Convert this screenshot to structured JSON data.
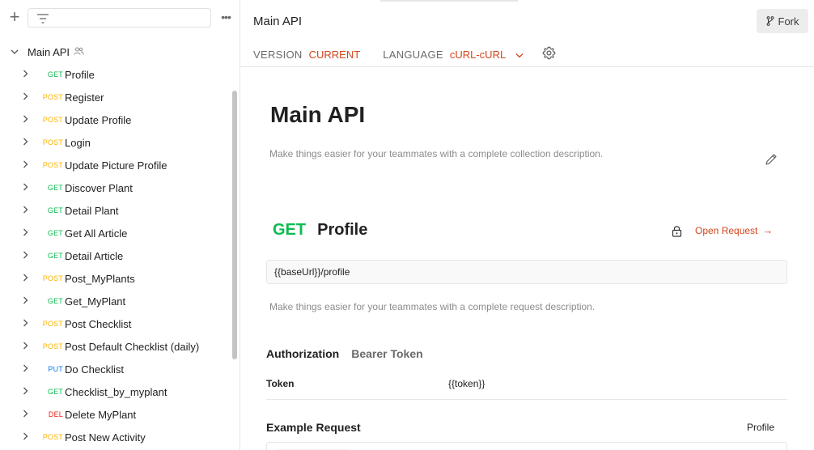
{
  "sidebar": {
    "collection": {
      "name": "Main API"
    },
    "requests": [
      {
        "method": "GET",
        "name": "Profile"
      },
      {
        "method": "POST",
        "name": "Register"
      },
      {
        "method": "POST",
        "name": "Update Profile"
      },
      {
        "method": "POST",
        "name": "Login"
      },
      {
        "method": "POST",
        "name": "Update Picture Profile"
      },
      {
        "method": "GET",
        "name": "Discover Plant"
      },
      {
        "method": "GET",
        "name": "Detail Plant"
      },
      {
        "method": "GET",
        "name": "Get All Article"
      },
      {
        "method": "GET",
        "name": "Detail Article"
      },
      {
        "method": "POST",
        "name": "Post_MyPlants"
      },
      {
        "method": "GET",
        "name": "Get_MyPlant"
      },
      {
        "method": "POST",
        "name": "Post Checklist"
      },
      {
        "method": "POST",
        "name": "Post Default Checklist (daily)"
      },
      {
        "method": "PUT",
        "name": "Do Checklist"
      },
      {
        "method": "GET",
        "name": "Checklist_by_myplant"
      },
      {
        "method": "DEL",
        "name": "Delete MyPlant"
      },
      {
        "method": "POST",
        "name": "Post New Activity"
      }
    ]
  },
  "header": {
    "title": "Main API",
    "fork_label": "Fork",
    "version_label": "VERSION",
    "version_value": "CURRENT",
    "language_label": "LANGUAGE",
    "language_value": "cURL-cURL"
  },
  "doc": {
    "title": "Main API",
    "description": "Make things easier for your teammates with a complete collection description."
  },
  "request": {
    "method": "GET",
    "name": "Profile",
    "open_label": "Open Request",
    "open_arrow": "→",
    "url": "{{baseUrl}}/profile",
    "description": "Make things easier for your teammates with a complete request description.",
    "auth_label": "Authorization",
    "auth_type": "Bearer Token",
    "token_key": "Token",
    "token_value": "{{token}}",
    "example_label": "Example Request",
    "example_name": "Profile"
  },
  "colors": {
    "accent": "#d4451b",
    "get": "#0cbb52",
    "post": "#ffb400",
    "put": "#097bed",
    "del": "#eb2013"
  }
}
